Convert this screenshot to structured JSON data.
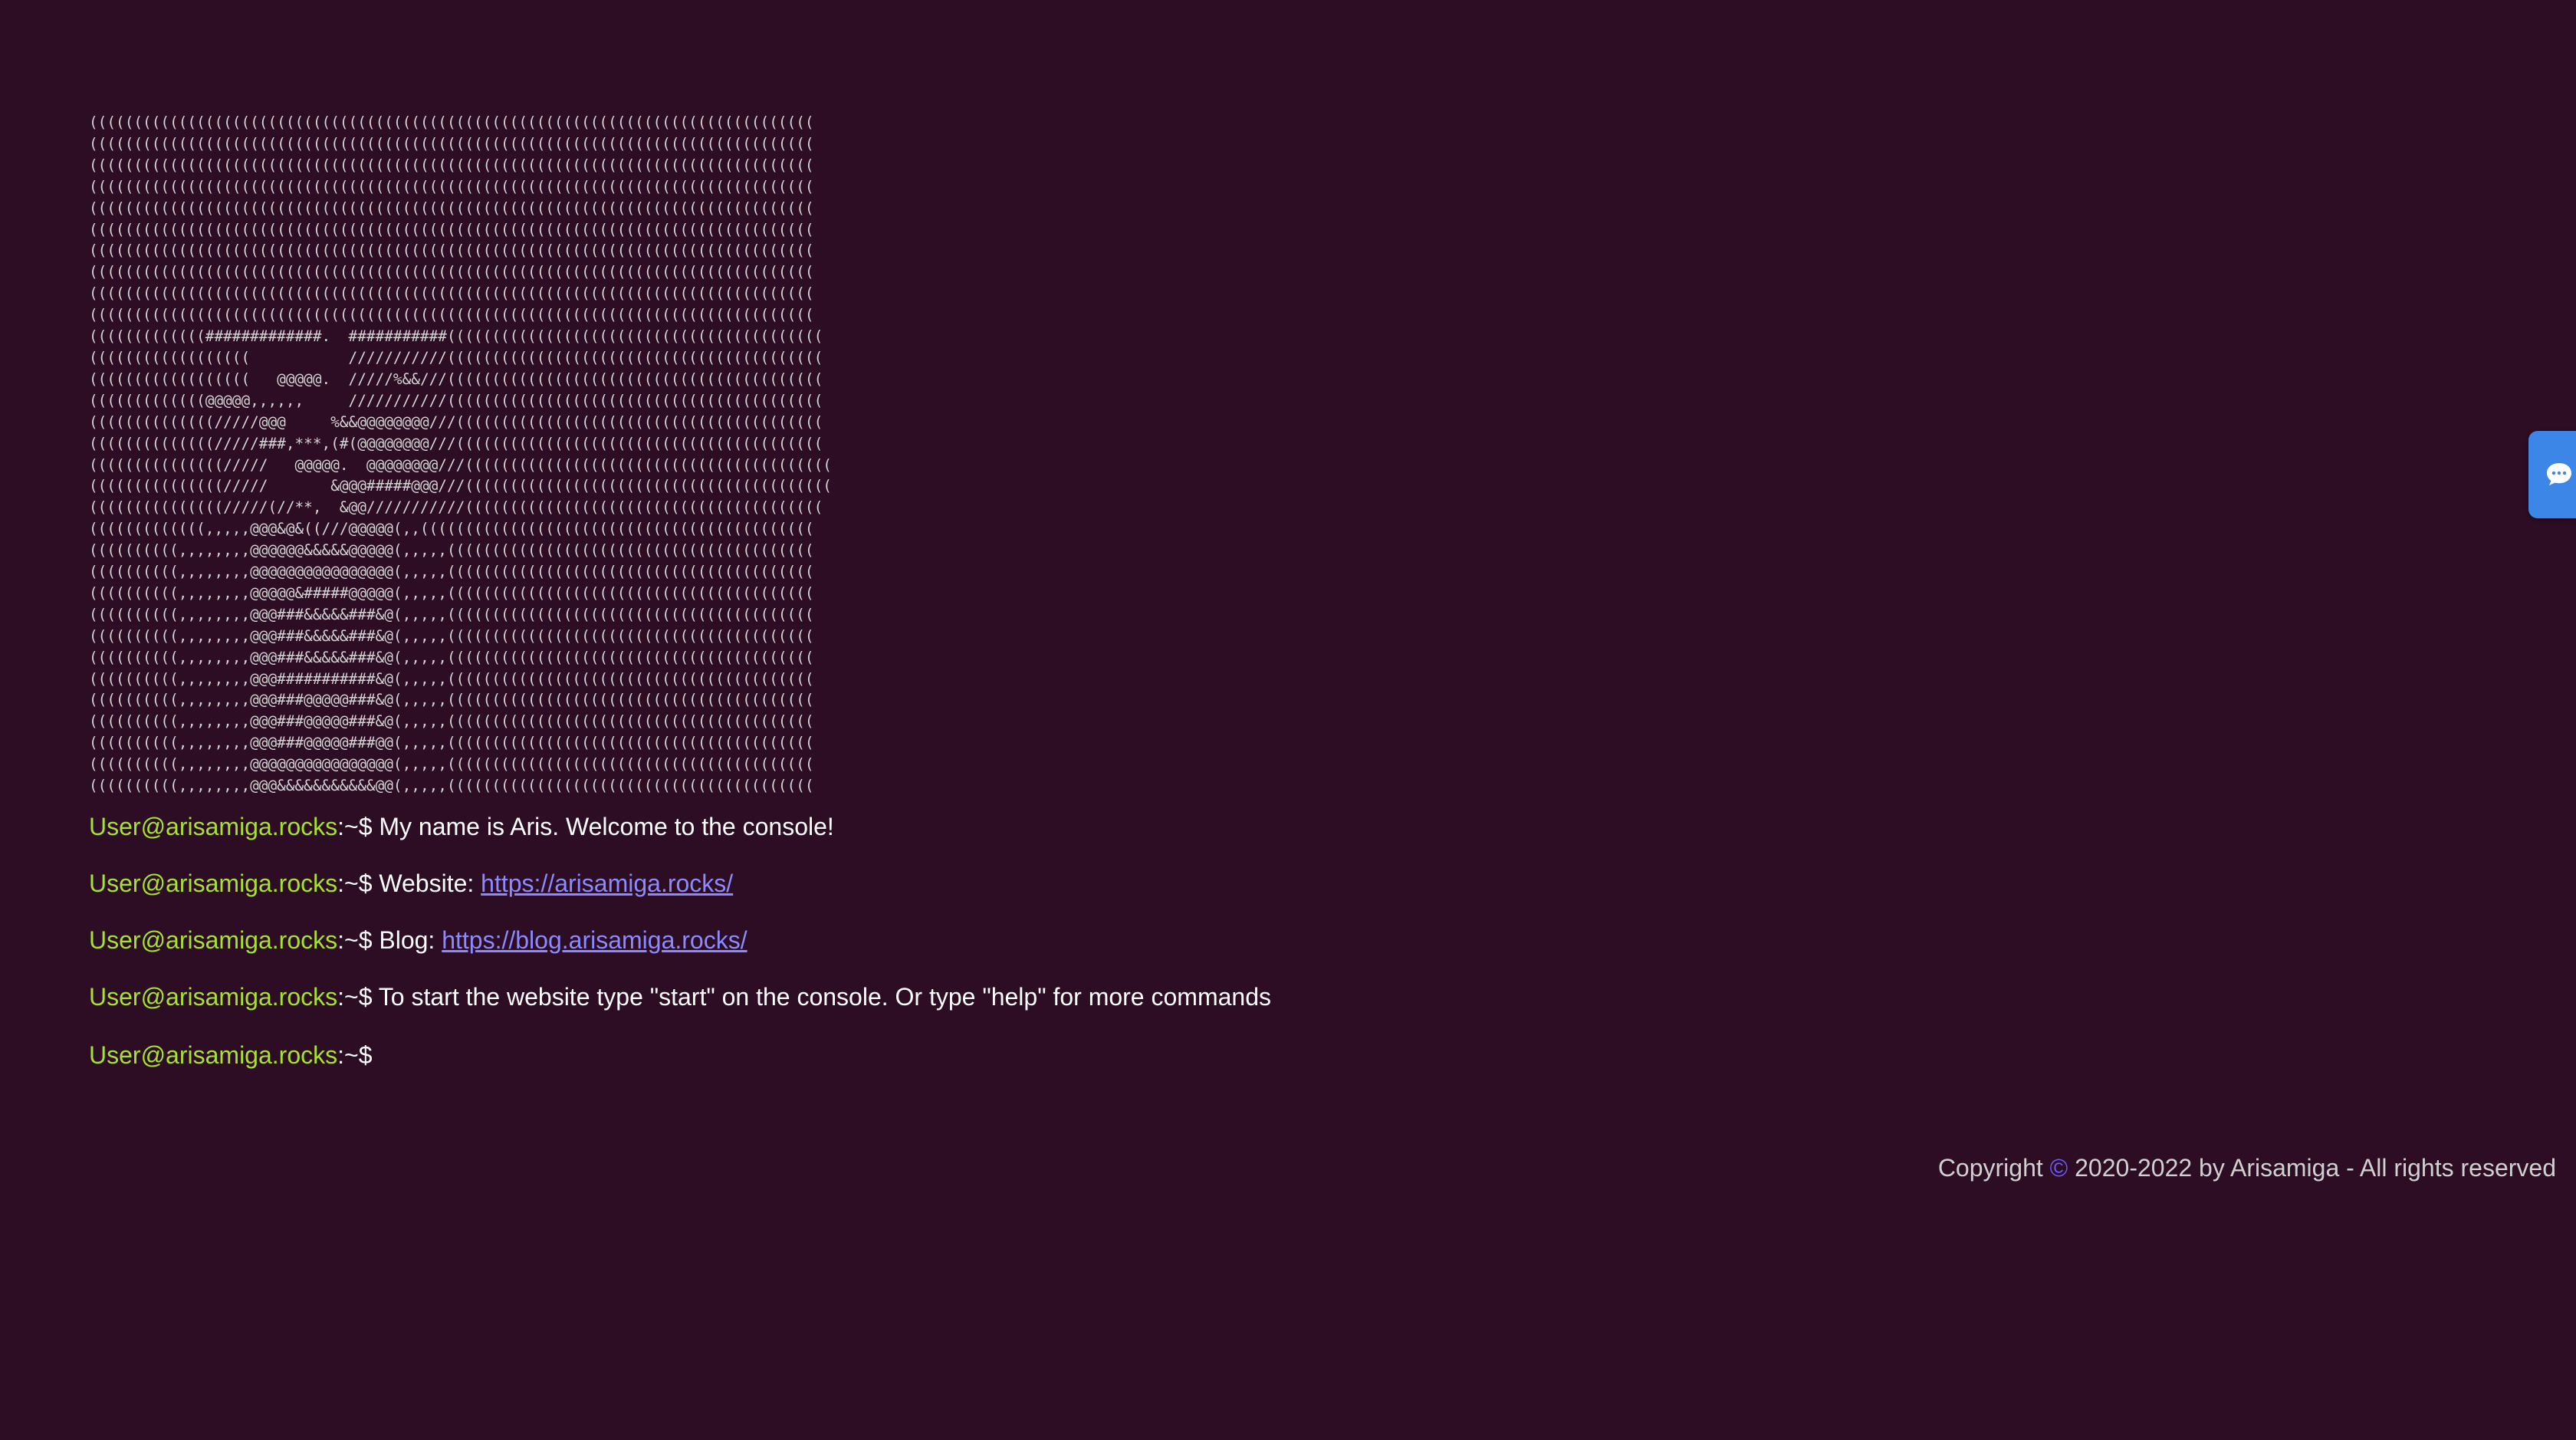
{
  "ascii_art": "(((((((((((((((((((((((((((((((((((((((((((((((((((((((((((((((((((((((((((((((((\n(((((((((((((((((((((((((((((((((((((((((((((((((((((((((((((((((((((((((((((((((\n(((((((((((((((((((((((((((((((((((((((((((((((((((((((((((((((((((((((((((((((((\n(((((((((((((((((((((((((((((((((((((((((((((((((((((((((((((((((((((((((((((((((\n(((((((((((((((((((((((((((((((((((((((((((((((((((((((((((((((((((((((((((((((((\n(((((((((((((((((((((((((((((((((((((((((((((((((((((((((((((((((((((((((((((((((\n(((((((((((((((((((((((((((((((((((((((((((((((((((((((((((((((((((((((((((((((((\n(((((((((((((((((((((((((((((((((((((((((((((((((((((((((((((((((((((((((((((((((\n(((((((((((((((((((((((((((((((((((((((((((((((((((((((((((((((((((((((((((((((((\n(((((((((((((((((((((((((((((((((((((((((((((((((((((((((((((((((((((((((((((((((\n(((((((((((((#############.  ###########((((((((((((((((((((((((((((((((((((((((((\n((((((((((((((((((           ///////////((((((((((((((((((((((((((((((((((((((((((\n((((((((((((((((((   @@@@@.  /////%&&///((((((((((((((((((((((((((((((((((((((((((\n(((((((((((((@@@@@,,,,,,     ///////////((((((((((((((((((((((((((((((((((((((((((\n((((((((((((((/////@@@     %&&@@@@@@@@///(((((((((((((((((((((((((((((((((((((((((\n((((((((((((((/////###,***,(#(@@@@@@@@///(((((((((((((((((((((((((((((((((((((((((\n(((((((((((((((/////   @@@@@.  @@@@@@@@///(((((((((((((((((((((((((((((((((((((((((\n(((((((((((((((/////       &@@@#####@@@///(((((((((((((((((((((((((((((((((((((((((\n(((((((((((((((/////(//**,  &@@///////////((((((((((((((((((((((((((((((((((((((((\n(((((((((((((,,,,,@@@&@&((///@@@@@(,,((((((((((((((((((((((((((((((((((((((((((((\n((((((((((,,,,,,,,@@@@@@&&&&&@@@@@(,,,,,(((((((((((((((((((((((((((((((((((((((((\n((((((((((,,,,,,,,@@@@@@@@@@@@@@@@(,,,,,(((((((((((((((((((((((((((((((((((((((((\n((((((((((,,,,,,,,@@@@@&#####@@@@@(,,,,,(((((((((((((((((((((((((((((((((((((((((\n((((((((((,,,,,,,,@@@###&&&&&###&@(,,,,,(((((((((((((((((((((((((((((((((((((((((\n((((((((((,,,,,,,,@@@###&&&&&###&@(,,,,,(((((((((((((((((((((((((((((((((((((((((\n((((((((((,,,,,,,,@@@###&&&&&###&@(,,,,,(((((((((((((((((((((((((((((((((((((((((\n((((((((((,,,,,,,,@@@###########&@(,,,,,(((((((((((((((((((((((((((((((((((((((((\n((((((((((,,,,,,,,@@@###@@@@@###&@(,,,,,(((((((((((((((((((((((((((((((((((((((((\n((((((((((,,,,,,,,@@@###@@@@@###&@(,,,,,(((((((((((((((((((((((((((((((((((((((((\n((((((((((,,,,,,,,@@@###@@@@@###@@(,,,,,(((((((((((((((((((((((((((((((((((((((((\n((((((((((,,,,,,,,@@@@@@@@@@@@@@@@(,,,,,(((((((((((((((((((((((((((((((((((((((((\n((((((((((,,,,,,,,@@@&&&&&&&&&&&@@(,,,,,(((((((((((((((((((((((((((((((((((((((((",
  "console": {
    "user": "User@arisamiga.rocks",
    "prompt": ":~$",
    "lines": [
      {
        "text": " My name is Aris. Welcome to the console!"
      },
      {
        "text": " Website: ",
        "link": "https://arisamiga.rocks/"
      },
      {
        "text": " Blog: ",
        "link": "https://blog.arisamiga.rocks/"
      },
      {
        "text": " To start the website type \"start\" on the console. Or type \"help\" for more commands"
      },
      {
        "text": ""
      }
    ]
  },
  "footer": {
    "prefix": "Copyright ",
    "symbol": "©",
    "suffix": " 2020-2022 by Arisamiga - All rights reserved"
  },
  "chat_widget": {
    "icon": "chat-bubble-icon"
  },
  "colors": {
    "background": "#2d0d24",
    "user": "#a6e22e",
    "link": "#8b8bff",
    "widget": "#3b86e6"
  }
}
